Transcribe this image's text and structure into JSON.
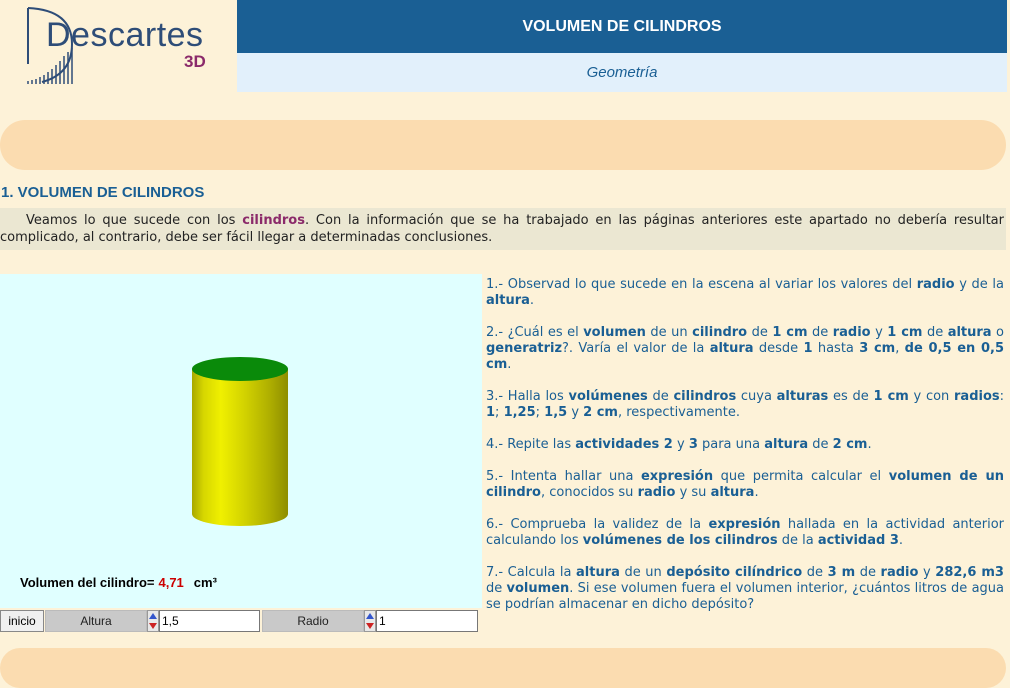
{
  "logo": {
    "text": "Descartes",
    "sub": "3D"
  },
  "header": {
    "title": "VOLUMEN DE CILINDROS",
    "subtitle": "Geometría"
  },
  "section": {
    "title": "1. VOLUMEN DE CILINDROS",
    "intro": {
      "pre": "Veamos lo que sucede con los ",
      "highlight": "cilindros",
      "post": ". Con la información que se ha trabajado en las páginas anteriores este apartado no debería resultar complicado, al contrario, debe ser fácil llegar a determinadas conclusiones."
    }
  },
  "scene": {
    "volume_label": "Volumen del cilindro=",
    "volume_value": "4,71",
    "volume_unit": "cm³",
    "colors": {
      "cylinder_body": "#d4d400",
      "cylinder_top": "#0a8a0a",
      "background": "#e0ffff"
    }
  },
  "controls": {
    "inicio": "inicio",
    "altura_label": "Altura",
    "altura_value": "1,5",
    "radio_label": "Radio",
    "radio_value": "1"
  },
  "activities": [
    [
      {
        "t": "1.- Observad lo que sucede en la escena al variar los valores del "
      },
      {
        "t": "radio",
        "b": true
      },
      {
        "t": " y de la "
      },
      {
        "t": "altura",
        "b": true
      },
      {
        "t": "."
      }
    ],
    [
      {
        "t": "2.- ¿Cuál es el "
      },
      {
        "t": "volumen",
        "b": true
      },
      {
        "t": " de un "
      },
      {
        "t": "cilindro",
        "b": true
      },
      {
        "t": " de "
      },
      {
        "t": "1 cm",
        "b": true
      },
      {
        "t": " de "
      },
      {
        "t": "radio",
        "b": true
      },
      {
        "t": " y "
      },
      {
        "t": "1 cm",
        "b": true
      },
      {
        "t": " de "
      },
      {
        "t": "altura",
        "b": true
      },
      {
        "t": " o "
      },
      {
        "t": "generatriz",
        "b": true
      },
      {
        "t": "?. Varía el valor de la "
      },
      {
        "t": "altura",
        "b": true
      },
      {
        "t": " desde "
      },
      {
        "t": "1",
        "b": true
      },
      {
        "t": " hasta "
      },
      {
        "t": "3 cm",
        "b": true
      },
      {
        "t": ", "
      },
      {
        "t": "de 0,5 en 0,5 cm",
        "b": true
      },
      {
        "t": "."
      }
    ],
    [
      {
        "t": "3.- Halla los "
      },
      {
        "t": "volúmenes",
        "b": true
      },
      {
        "t": " de "
      },
      {
        "t": "cilindros",
        "b": true
      },
      {
        "t": " cuya "
      },
      {
        "t": "alturas",
        "b": true
      },
      {
        "t": " es de "
      },
      {
        "t": "1 cm",
        "b": true
      },
      {
        "t": " y con "
      },
      {
        "t": "radios",
        "b": true
      },
      {
        "t": ": "
      },
      {
        "t": "1",
        "b": true
      },
      {
        "t": "; "
      },
      {
        "t": "1,25",
        "b": true
      },
      {
        "t": "; "
      },
      {
        "t": "1,5",
        "b": true
      },
      {
        "t": " y "
      },
      {
        "t": "2 cm",
        "b": true
      },
      {
        "t": ", respectivamente."
      }
    ],
    [
      {
        "t": "4.- Repite las "
      },
      {
        "t": "actividades 2",
        "b": true
      },
      {
        "t": " y "
      },
      {
        "t": "3",
        "b": true
      },
      {
        "t": " para una "
      },
      {
        "t": "altura",
        "b": true
      },
      {
        "t": " de "
      },
      {
        "t": "2 cm",
        "b": true
      },
      {
        "t": "."
      }
    ],
    [
      {
        "t": "5.- Intenta hallar una "
      },
      {
        "t": "expresión",
        "b": true
      },
      {
        "t": " que permita calcular el "
      },
      {
        "t": "volumen de un cilindro",
        "b": true
      },
      {
        "t": ", conocidos su "
      },
      {
        "t": "radio",
        "b": true
      },
      {
        "t": " y su "
      },
      {
        "t": "altura",
        "b": true
      },
      {
        "t": "."
      }
    ],
    [
      {
        "t": "6.- Comprueba la validez de la "
      },
      {
        "t": "expresión",
        "b": true
      },
      {
        "t": " hallada en la actividad anterior calculando los "
      },
      {
        "t": "volúmenes de los cilindros",
        "b": true
      },
      {
        "t": " de la "
      },
      {
        "t": "actividad 3",
        "b": true
      },
      {
        "t": "."
      }
    ],
    [
      {
        "t": "7.- Calcula la "
      },
      {
        "t": "altura",
        "b": true
      },
      {
        "t": " de un "
      },
      {
        "t": "depósito cilíndrico",
        "b": true
      },
      {
        "t": " de "
      },
      {
        "t": "3 m",
        "b": true
      },
      {
        "t": " de "
      },
      {
        "t": "radio",
        "b": true
      },
      {
        "t": " y "
      },
      {
        "t": "282,6 m3",
        "b": true
      },
      {
        "t": " de "
      },
      {
        "t": "volumen",
        "b": true
      },
      {
        "t": ". Si ese volumen fuera el volumen interior, ¿cuántos litros de agua se podrían almacenar en dicho depósito?"
      }
    ]
  ]
}
